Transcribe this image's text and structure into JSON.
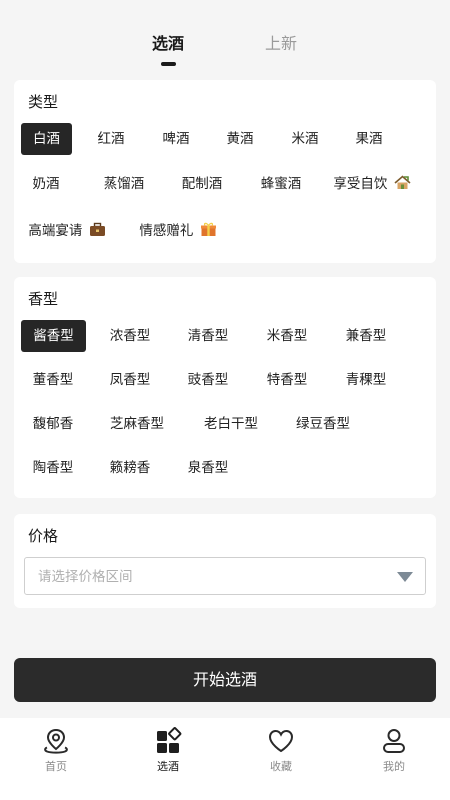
{
  "top_tabs": [
    {
      "label": "选酒",
      "active": true
    },
    {
      "label": "上新",
      "active": false
    }
  ],
  "category": {
    "title": "类型",
    "selected": "白酒",
    "items": [
      "白酒",
      "红酒",
      "啤酒",
      "黄酒",
      "米酒",
      "果酒",
      "奶酒",
      "蒸馏酒",
      "配制酒",
      "蜂蜜酒",
      "享受自饮",
      "高端宴请",
      "情感赠礼"
    ]
  },
  "aroma": {
    "title": "香型",
    "selected": "酱香型",
    "items": [
      "酱香型",
      "浓香型",
      "清香型",
      "米香型",
      "兼香型",
      "董香型",
      "凤香型",
      "豉香型",
      "特香型",
      "青稞型",
      "馥郁香",
      "芝麻香型",
      "老白干型",
      "绿豆香型",
      "陶香型",
      "籁耪香",
      "泉香型"
    ]
  },
  "price": {
    "title": "价格",
    "placeholder": "请选择价格区间"
  },
  "start_button": "开始选酒",
  "bottom_nav": [
    {
      "label": "首页",
      "icon": "location-pin-icon",
      "active": false
    },
    {
      "label": "选酒",
      "icon": "category-grid-icon",
      "active": true
    },
    {
      "label": "收藏",
      "icon": "heart-icon",
      "active": false
    },
    {
      "label": "我的",
      "icon": "person-icon",
      "active": false
    }
  ]
}
